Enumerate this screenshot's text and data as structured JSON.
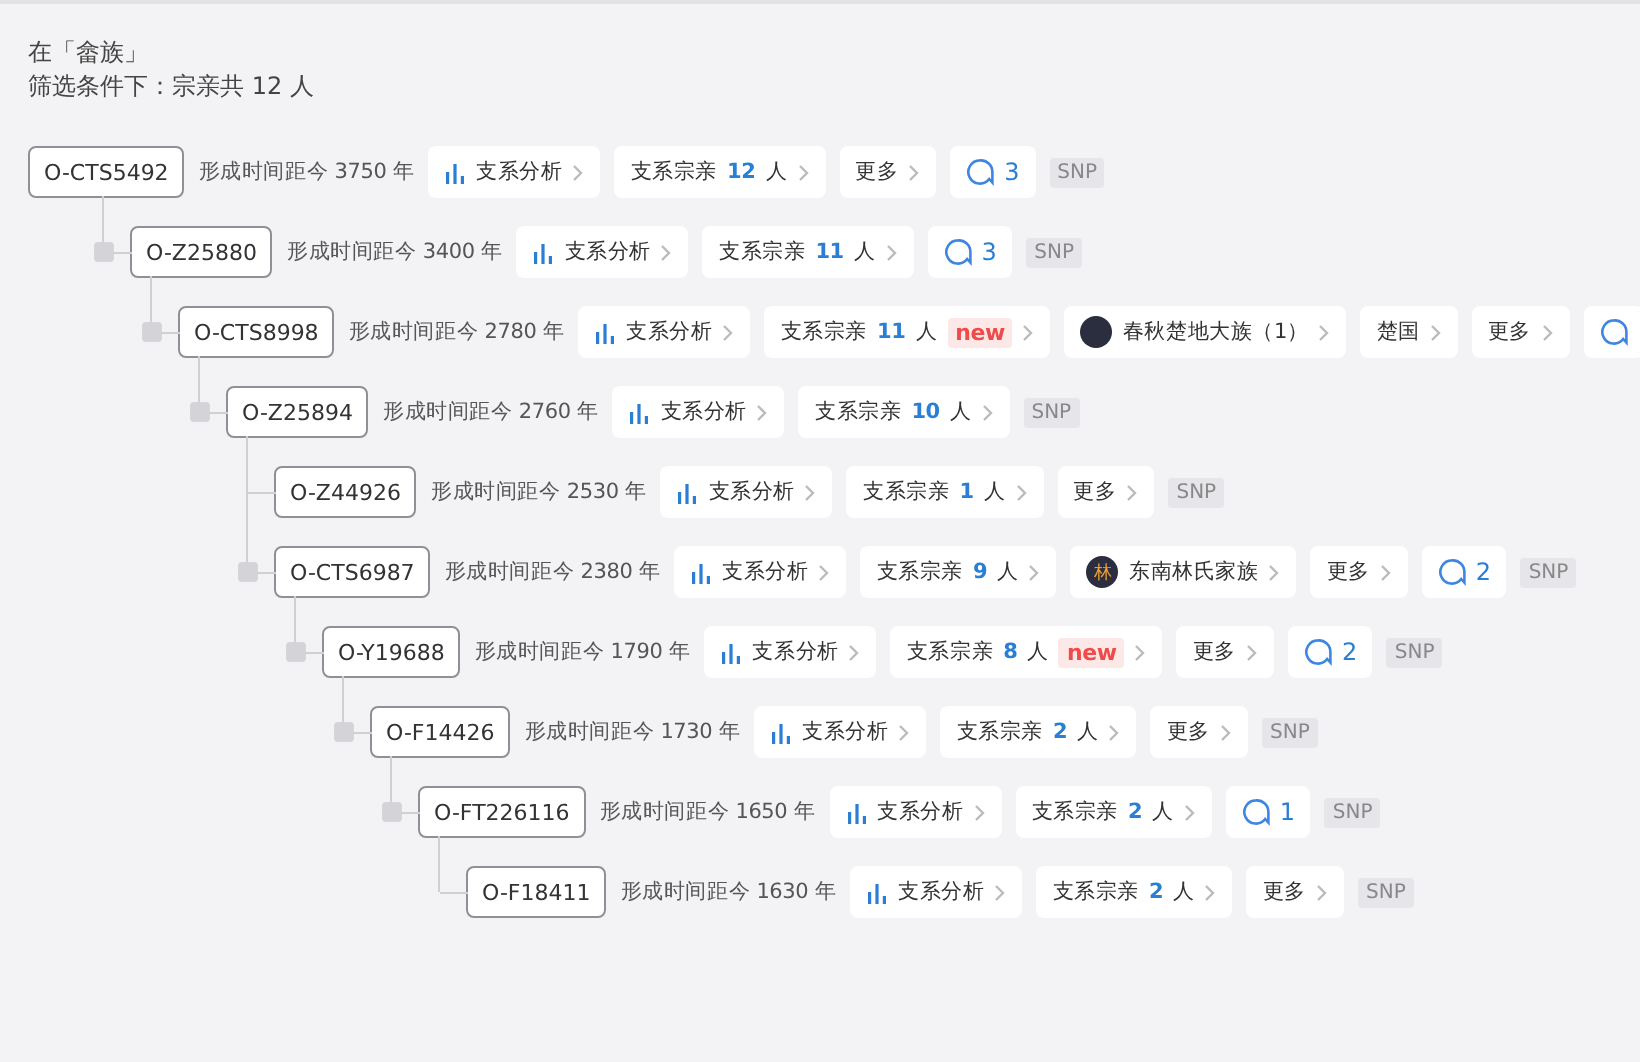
{
  "header": {
    "lines": [
      "在「畲族」",
      "筛选条件下：宗亲共 12 人"
    ]
  },
  "tree": [
    {
      "name": "O-CTS5492",
      "age": "形成时间距今 3750 年",
      "tag": "SNP",
      "chips": [
        {
          "kind": "analysis",
          "label": "支系分析"
        },
        {
          "kind": "relatives",
          "label": "支系宗亲 **12** 人"
        },
        {
          "kind": "more",
          "label": "更多"
        },
        {
          "kind": "comments",
          "count": "3"
        }
      ],
      "children": [
        {
          "name": "O-Z25880",
          "age": "形成时间距今 3400 年",
          "tag": "SNP",
          "chips": [
            {
              "kind": "analysis",
              "label": "支系分析"
            },
            {
              "kind": "relatives",
              "label": "支系宗亲 **11** 人"
            },
            {
              "kind": "comments",
              "count": "3"
            }
          ],
          "children": [
            {
              "name": "O-CTS8998",
              "age": "形成时间距今 2780 年",
              "chips": [
                {
                  "kind": "analysis",
                  "label": "支系分析"
                },
                {
                  "kind": "relatives",
                  "label": "支系宗亲 **11** 人",
                  "badge": "new"
                },
                {
                  "kind": "clan",
                  "label": "春秋楚地大族（1）"
                },
                {
                  "kind": "plain",
                  "label": "楚国"
                },
                {
                  "kind": "more",
                  "label": "更多"
                },
                {
                  "kind": "comments"
                }
              ],
              "children": [
                {
                  "name": "O-Z25894",
                  "age": "形成时间距今 2760 年",
                  "tag": "SNP",
                  "chips": [
                    {
                      "kind": "analysis",
                      "label": "支系分析"
                    },
                    {
                      "kind": "relatives",
                      "label": "支系宗亲 **10** 人"
                    }
                  ],
                  "children": [
                    {
                      "name": "O-Z44926",
                      "age": "形成时间距今 2530 年",
                      "tag": "SNP",
                      "chips": [
                        {
                          "kind": "analysis",
                          "label": "支系分析"
                        },
                        {
                          "kind": "relatives",
                          "label": "支系宗亲 **1** 人"
                        },
                        {
                          "kind": "more",
                          "label": "更多"
                        }
                      ]
                    },
                    {
                      "name": "O-CTS6987",
                      "age": "形成时间距今 2380 年",
                      "tag": "SNP",
                      "chips": [
                        {
                          "kind": "analysis",
                          "label": "支系分析"
                        },
                        {
                          "kind": "relatives",
                          "label": "支系宗亲 **9** 人"
                        },
                        {
                          "kind": "clan",
                          "label": "东南林氏家族",
                          "avatar": "林"
                        },
                        {
                          "kind": "more",
                          "label": "更多"
                        },
                        {
                          "kind": "comments",
                          "count": "2"
                        }
                      ],
                      "children": [
                        {
                          "name": "O-Y19688",
                          "age": "形成时间距今 1790 年",
                          "tag": "SNP",
                          "chips": [
                            {
                              "kind": "analysis",
                              "label": "支系分析"
                            },
                            {
                              "kind": "relatives",
                              "label": "支系宗亲 **8** 人",
                              "badge": "new"
                            },
                            {
                              "kind": "more",
                              "label": "更多"
                            },
                            {
                              "kind": "comments",
                              "count": "2"
                            }
                          ],
                          "children": [
                            {
                              "name": "O-F14426",
                              "age": "形成时间距今 1730 年",
                              "tag": "SNP",
                              "chips": [
                                {
                                  "kind": "analysis",
                                  "label": "支系分析"
                                },
                                {
                                  "kind": "relatives",
                                  "label": "支系宗亲 **2** 人"
                                },
                                {
                                  "kind": "more",
                                  "label": "更多"
                                }
                              ],
                              "children": [
                                {
                                  "name": "O-FT226116",
                                  "age": "形成时间距今 1650 年",
                                  "tag": "SNP",
                                  "chips": [
                                    {
                                      "kind": "analysis",
                                      "label": "支系分析"
                                    },
                                    {
                                      "kind": "relatives",
                                      "label": "支系宗亲 **2** 人"
                                    },
                                    {
                                      "kind": "comments",
                                      "count": "1"
                                    }
                                  ],
                                  "children": [
                                    {
                                      "name": "O-F18411",
                                      "age": "形成时间距今 1630 年",
                                      "tag": "SNP",
                                      "chips": [
                                        {
                                          "kind": "analysis",
                                          "label": "支系分析"
                                        },
                                        {
                                          "kind": "relatives",
                                          "label": "支系宗亲 **2** 人"
                                        },
                                        {
                                          "kind": "more",
                                          "label": "更多"
                                        }
                                      ]
                                    }
                                  ]
                                }
                              ]
                            }
                          ]
                        }
                      ]
                    }
                  ]
                }
              ]
            }
          ]
        }
      ]
    }
  ]
}
